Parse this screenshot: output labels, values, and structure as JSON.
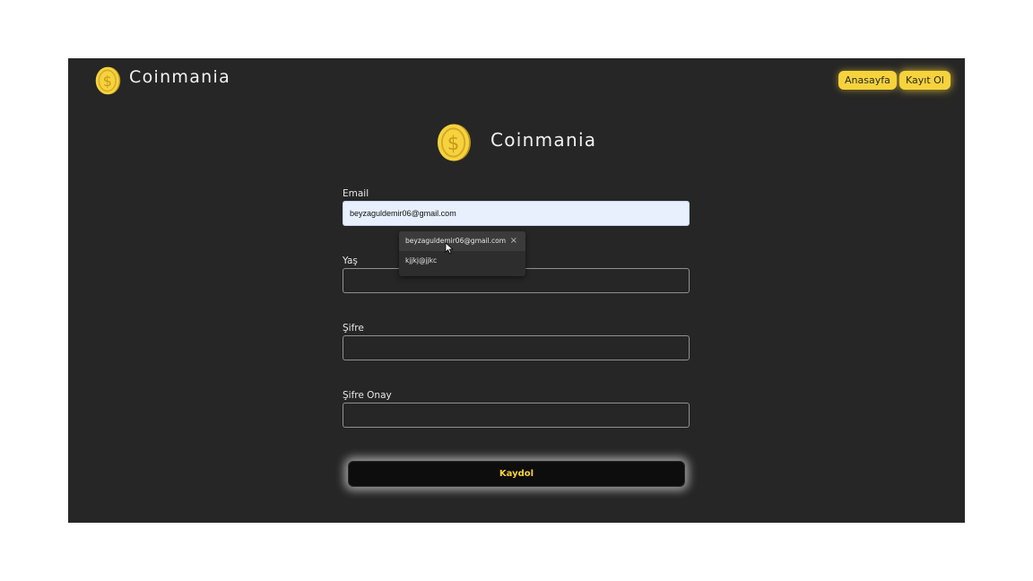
{
  "brand": {
    "name": "Coinmania",
    "coin_color": "#f6d33c"
  },
  "nav": {
    "home_label": "Anasayfa",
    "register_label": "Kayıt Ol"
  },
  "hero": {
    "title": "Coinmania"
  },
  "form": {
    "email": {
      "label": "Email",
      "value": "beyzaguldemir06@gmail.com"
    },
    "age": {
      "label": "Yaş",
      "value": ""
    },
    "password": {
      "label": "Şifre",
      "value": ""
    },
    "password_confirm": {
      "label": "Şifre Onay",
      "value": ""
    },
    "submit_label": "Kaydol"
  },
  "autocomplete": {
    "items": [
      {
        "text": "beyzaguldemir06@gmail.com",
        "close": "×"
      },
      {
        "text": "kjjkj@jjkc"
      }
    ]
  },
  "colors": {
    "background": "#262626",
    "accent": "#f6d33c",
    "autofill": "#e8f0fe"
  },
  "icons": {
    "coin": "dollar-coin-icon",
    "cursor": "mouse-pointer-icon"
  }
}
